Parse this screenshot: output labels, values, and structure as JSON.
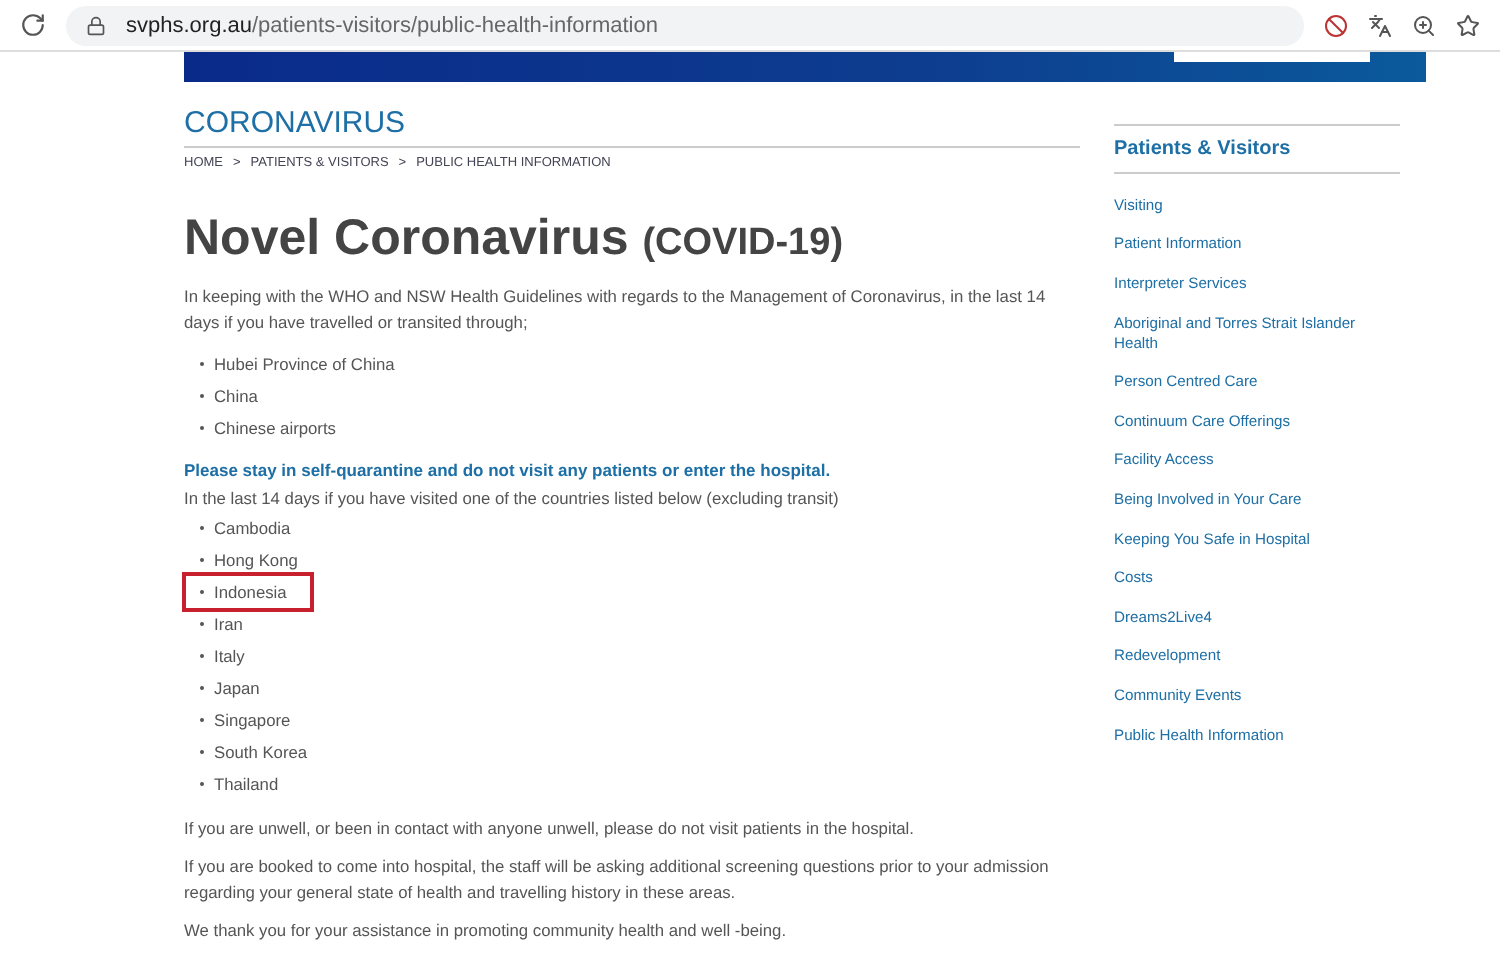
{
  "browser": {
    "url_host": "svphs.org.au",
    "url_path": "/patients-visitors/public-health-information"
  },
  "section_title": "CORONAVIRUS",
  "breadcrumb": [
    "HOME",
    "PATIENTS & VISITORS",
    "PUBLIC HEALTH INFORMATION"
  ],
  "breadcrumb_separator": ">",
  "heading": {
    "main": "Novel Coronavirus",
    "suffix": "(COVID-19)"
  },
  "intro": "In keeping with the WHO and NSW Health Guidelines with regards to the Management of Coronavirus, in the last 14 days if you have travelled or transited through;",
  "transit_list": [
    "Hubei Province of China",
    "China",
    "Chinese airports"
  ],
  "warning": "Please stay in self-quarantine and do not visit any patients or enter the hospital.",
  "countries_intro": "In the last 14 days if you have visited one of the countries listed below (excluding transit)",
  "countries": [
    {
      "name": "Cambodia",
      "highlighted": false
    },
    {
      "name": "Hong Kong",
      "highlighted": false
    },
    {
      "name": "Indonesia",
      "highlighted": true
    },
    {
      "name": "Iran",
      "highlighted": false
    },
    {
      "name": "Italy",
      "highlighted": false
    },
    {
      "name": "Japan",
      "highlighted": false
    },
    {
      "name": "Singapore",
      "highlighted": false
    },
    {
      "name": "South Korea",
      "highlighted": false
    },
    {
      "name": "Thailand",
      "highlighted": false
    }
  ],
  "closing": [
    "If you are unwell, or been in contact with anyone unwell, please do not visit patients in the hospital.",
    "If you are booked to come into hospital, the staff will be asking additional screening questions prior to your admission regarding your general state of health and travelling history in these areas.",
    "We thank you for your assistance in promoting community health and well -being."
  ],
  "sidebar": {
    "title": "Patients & Visitors",
    "items": [
      "Visiting",
      "Patient Information",
      "Interpreter Services",
      "Aboriginal and Torres Strait Islander Health",
      "Person Centred Care",
      "Continuum Care Offerings",
      "Facility Access",
      "Being Involved in Your Care",
      "Keeping You Safe in Hospital",
      "Costs",
      "Dreams2Live4",
      "Redevelopment",
      "Community Events",
      "Public Health Information"
    ]
  }
}
